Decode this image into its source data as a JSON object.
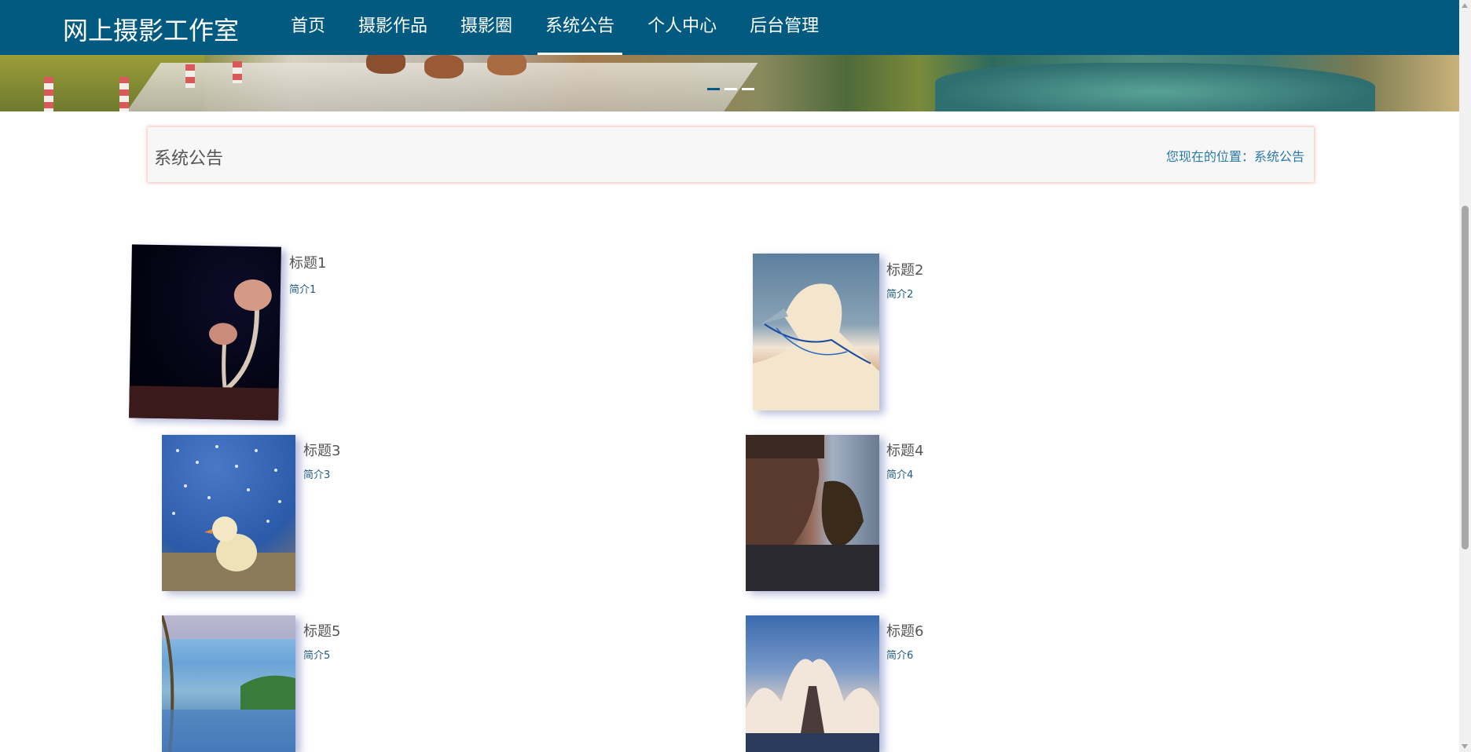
{
  "app": {
    "title": "网上摄影工作室"
  },
  "nav": {
    "items": [
      {
        "label": "首页"
      },
      {
        "label": "摄影作品"
      },
      {
        "label": "摄影圈"
      },
      {
        "label": "系统公告",
        "active": true
      },
      {
        "label": "个人中心"
      },
      {
        "label": "后台管理"
      }
    ]
  },
  "banner": {
    "slides": 3,
    "active_slide": 1
  },
  "section": {
    "title": "系统公告",
    "breadcrumb_prefix": "您现在的位置：",
    "breadcrumb_current": "系统公告"
  },
  "notices": [
    {
      "title": "标题1",
      "summary": "简介1",
      "image": "mushroom-photo"
    },
    {
      "title": "标题2",
      "summary": "简介2",
      "image": "gannet-bird-photo"
    },
    {
      "title": "标题3",
      "summary": "简介3",
      "image": "chick-with-birds-photo"
    },
    {
      "title": "标题4",
      "summary": "简介4",
      "image": "falconer-with-eagle-photo"
    },
    {
      "title": "标题5",
      "summary": "简介5",
      "image": "lake-reflection-photo"
    },
    {
      "title": "标题6",
      "summary": "简介6",
      "image": "white-arch-building-photo"
    }
  ],
  "colors": {
    "nav_bg": "#025a80",
    "breadcrumb": "#2a7aa8",
    "summary": "#1e5a88"
  }
}
